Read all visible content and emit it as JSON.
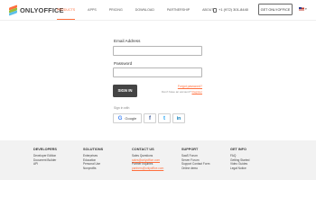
{
  "header": {
    "logo_text": "ONLYOFFICE",
    "nav": [
      {
        "label": "Products",
        "active": true
      },
      {
        "label": "Apps",
        "active": false
      },
      {
        "label": "Pricing",
        "active": false
      },
      {
        "label": "Download",
        "active": false
      },
      {
        "label": "Partnership",
        "active": false
      },
      {
        "label": "About",
        "active": false
      }
    ],
    "phone": "+1 (972) 301-8440",
    "get_button": "Get OnlyOffice",
    "language_icon": "us-flag-icon"
  },
  "form": {
    "email_label": "Email Address",
    "email_value": "",
    "password_label": "Password",
    "password_value": "",
    "signin_button": "Sign in",
    "forgot_link": "Forgot password?",
    "no_account_text": "Don't have an account?",
    "register_link": "Register",
    "signin_with": "Sign in with",
    "social": {
      "google_label": "Google",
      "google_icon": "G",
      "facebook_icon": "f",
      "twitter_icon": "t",
      "linkedin_icon": "in"
    }
  },
  "footer": {
    "columns": [
      {
        "title": "Developers",
        "links": [
          {
            "text": "Developer Edition",
            "highlight": false
          },
          {
            "text": "Document Builder",
            "highlight": false
          },
          {
            "text": "API",
            "highlight": false
          }
        ]
      },
      {
        "title": "Solutions",
        "links": [
          {
            "text": "Enterprises",
            "highlight": false
          },
          {
            "text": "Education",
            "highlight": false
          },
          {
            "text": "Personal Use",
            "highlight": false
          },
          {
            "text": "Nonprofits",
            "highlight": false
          }
        ]
      },
      {
        "title": "Contact Us",
        "links": [
          {
            "text": "Sales Questions",
            "highlight": false
          },
          {
            "text": "sales@onlyoffice.com",
            "highlight": true
          },
          {
            "text": "Partner Inquiries",
            "highlight": false
          },
          {
            "text": "partners@onlyoffice.com",
            "highlight": true
          }
        ]
      },
      {
        "title": "Support",
        "links": [
          {
            "text": "SaaS Forum",
            "highlight": false
          },
          {
            "text": "Server Forum",
            "highlight": false
          },
          {
            "text": "Support Contact Form",
            "highlight": false
          },
          {
            "text": "Online demo",
            "highlight": false
          }
        ]
      },
      {
        "title": "Get Info",
        "links": [
          {
            "text": "FAQ",
            "highlight": false
          },
          {
            "text": "Getting Started",
            "highlight": false
          },
          {
            "text": "Video Guides",
            "highlight": false
          },
          {
            "text": "Legal Notice",
            "highlight": false
          }
        ]
      }
    ]
  },
  "colors": {
    "accent": "#ff6f3d",
    "button_dark": "#444444",
    "footer_bg": "#f2f2f2"
  }
}
